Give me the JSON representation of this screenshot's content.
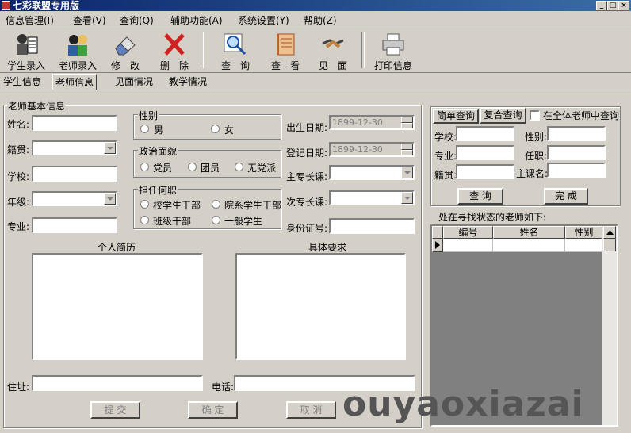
{
  "window": {
    "title": "七彩联盟专用版",
    "min": "_",
    "max": "□",
    "close": "×"
  },
  "menu": [
    "信息管理(I)",
    "查看(V)",
    "查询(Q)",
    "辅助功能(A)",
    "系统设置(Y)",
    "帮助(Z)"
  ],
  "toolbar": {
    "student_entry": "学生录入",
    "teacher_entry": "老师录入",
    "modify": "修　改",
    "delete": "删　除",
    "query": "查　询",
    "view": "查　看",
    "meet": "见　面",
    "print": "打印信息"
  },
  "tabs": [
    "学生信息",
    "老师信息",
    "见面情况",
    "教学情况"
  ],
  "form": {
    "group_title": "老师基本信息",
    "name": "姓名:",
    "native": "籍贯:",
    "school": "学校:",
    "grade": "年级:",
    "major": "专业:",
    "gender_title": "性别",
    "male": "男",
    "female": "女",
    "politics_title": "政治面貌",
    "party": "党员",
    "league": "团员",
    "nonparty": "无党派",
    "position_title": "担任何职",
    "school_cadre": "校学生干部",
    "dept_cadre": "院系学生干部",
    "class_cadre": "班级干部",
    "normal_student": "一般学生",
    "birth_label": "出生日期:",
    "birth_value": "1899-12-30",
    "reg_label": "登记日期:",
    "reg_value": "1899-12-30",
    "main_course": "主专长课:",
    "sub_course": "次专长课:",
    "id_card": "身份证号:",
    "resume_title": "个人简历",
    "requirement_title": "具体要求",
    "address": "住址:",
    "phone": "电话:",
    "submit": "提 交",
    "confirm": "确 定",
    "cancel": "取 消"
  },
  "search": {
    "tab_simple": "简单查询",
    "tab_complex": "复合查询",
    "all_check": "在全体老师中查询",
    "school": "学校:",
    "gender": "性别:",
    "major": "专业:",
    "position": "任职:",
    "native": "籍贯:",
    "main_course": "主课名:",
    "query_btn": "查 询",
    "done_btn": "完 成",
    "result_label": "处在寻找状态的老师如下:",
    "columns": [
      "编号",
      "姓名",
      "性别"
    ]
  },
  "watermark": "ouyaoxiazai"
}
